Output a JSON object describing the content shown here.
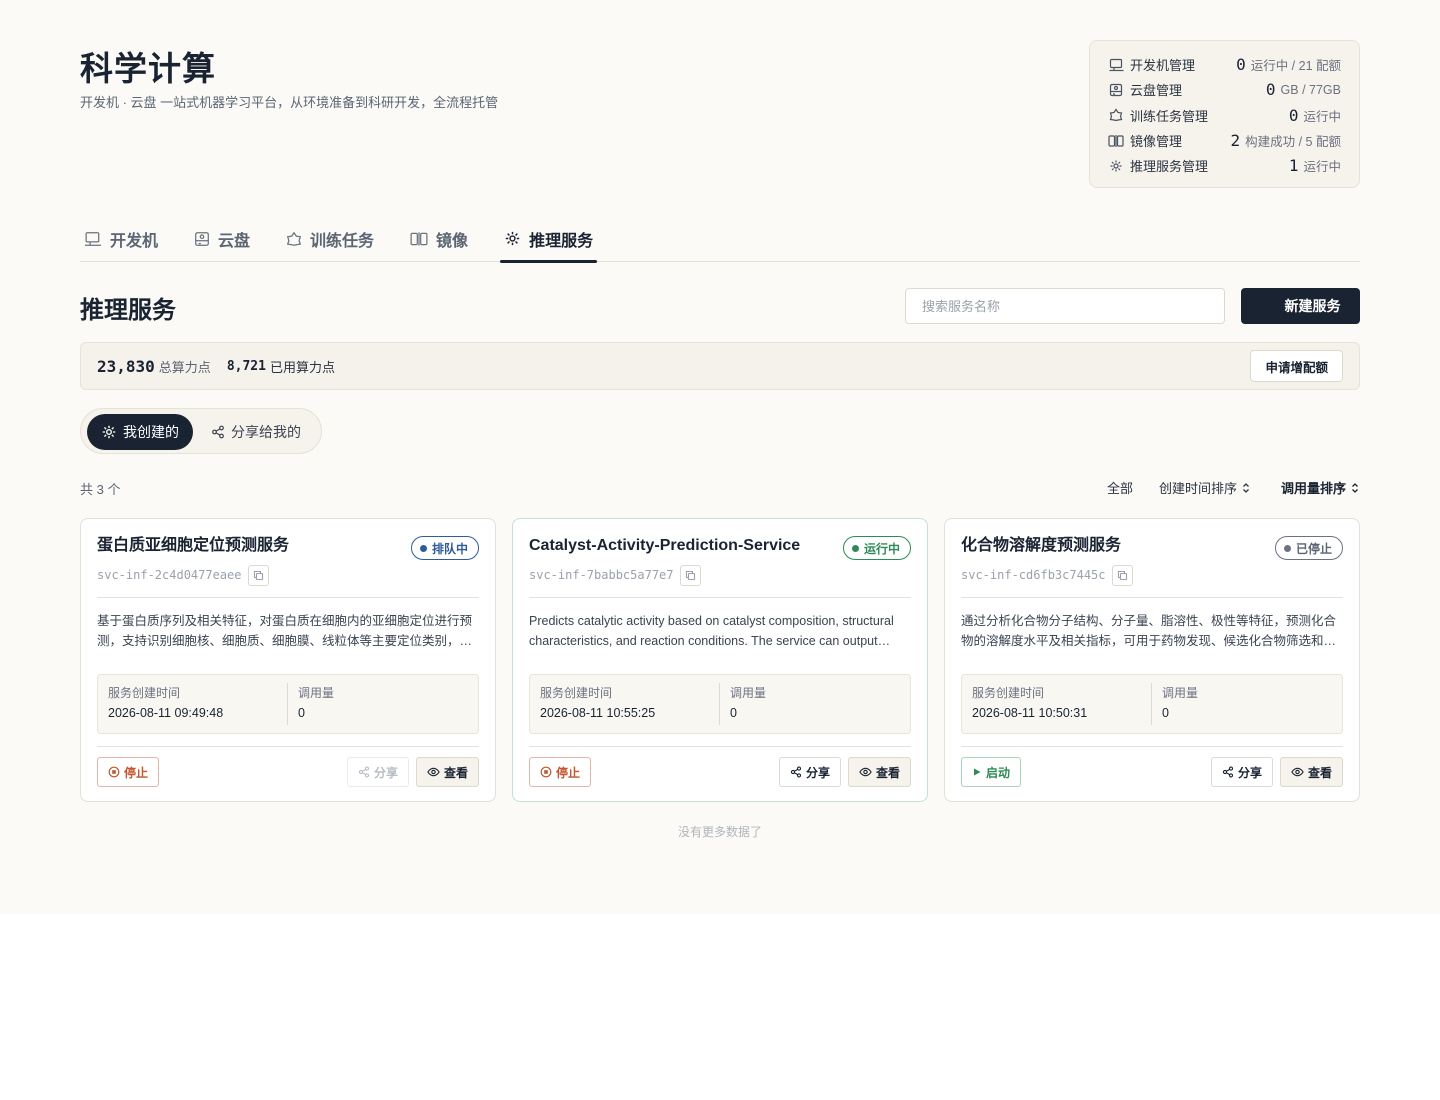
{
  "header": {
    "title": "科学计算",
    "subtitle": "开发机 · 云盘 一站式机器学习平台，从环境准备到科研开发，全流程托管"
  },
  "stats": [
    {
      "icon": "dev-machine-icon",
      "label": "开发机管理",
      "value": "0",
      "unit": "运行中 / 21 配额"
    },
    {
      "icon": "cloud-disk-icon",
      "label": "云盘管理",
      "value": "0",
      "unit": "GB / 77GB"
    },
    {
      "icon": "training-icon",
      "label": "训练任务管理",
      "value": "0",
      "unit": "运行中"
    },
    {
      "icon": "image-icon",
      "label": "镜像管理",
      "value": "2",
      "unit": "构建成功 / 5 配额"
    },
    {
      "icon": "inference-icon",
      "label": "推理服务管理",
      "value": "1",
      "unit": "运行中"
    }
  ],
  "tabs": [
    {
      "label": "开发机",
      "icon": "dev-machine-icon"
    },
    {
      "label": "云盘",
      "icon": "cloud-disk-icon"
    },
    {
      "label": "训练任务",
      "icon": "training-icon"
    },
    {
      "label": "镜像",
      "icon": "image-icon"
    },
    {
      "label": "推理服务",
      "icon": "inference-icon",
      "active": true
    }
  ],
  "section": {
    "title": "推理服务",
    "search_placeholder": "搜索服务名称",
    "new_button": "新建服务"
  },
  "quota": {
    "total_value": "23,830",
    "total_label": "总算力点",
    "used_value": "8,721",
    "used_label": "已用算力点",
    "request_button": "申请增配额"
  },
  "segment": {
    "mine": "我创建的",
    "shared": "分享给我的"
  },
  "list": {
    "count": "共 3 个",
    "filter_all": "全部",
    "sort_created": "创建时间排序",
    "sort_calls": "调用量排序",
    "no_more": "没有更多数据了"
  },
  "labels": {
    "created_time": "服务创建时间",
    "calls": "调用量",
    "stop": "停止",
    "start": "启动",
    "share": "分享",
    "view": "查看"
  },
  "cards": [
    {
      "name": "蛋白质亚细胞定位预测服务",
      "id": "svc-inf-2c4d0477eaee",
      "status": "排队中",
      "status_color": "#2f5c99",
      "description": "基于蛋白质序列及相关特征，对蛋白质在细胞内的亚细胞定位进行预测，支持识别细胞核、细胞质、细胞膜、线粒体等主要定位类别，为蛋白质功能研究提供参考。",
      "created_time": "2026-08-11 09:49:48",
      "calls": "0"
    },
    {
      "name": "Catalyst-Activity-Prediction-Service",
      "id": "svc-inf-7babbc5a77e7",
      "status": "运行中",
      "status_color": "#2e8a57",
      "description": "Predicts catalytic activity based on catalyst composition, structural characteristics, and reaction conditions. The service can output predicted activity values for catalyst screening.",
      "created_time": "2026-08-11 10:55:25",
      "calls": "0"
    },
    {
      "name": "化合物溶解度预测服务",
      "id": "svc-inf-cd6fb3c7445c",
      "status": "已停止",
      "status_color": "#6b7280",
      "description": "通过分析化合物分子结构、分子量、脂溶性、极性等特征，预测化合物的溶解度水平及相关指标，可用于药物发现、候选化合物筛选和分子设计等场景。",
      "created_time": "2026-08-11 10:50:31",
      "calls": "0"
    }
  ]
}
